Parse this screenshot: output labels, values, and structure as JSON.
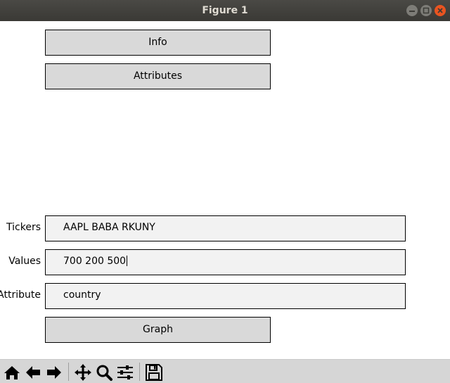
{
  "window": {
    "title": "Figure 1"
  },
  "buttons": {
    "info": "Info",
    "attributes": "Attributes",
    "graph": "Graph"
  },
  "fields": {
    "tickers": {
      "label": "Tickers",
      "value": "AAPL BABA RKUNY"
    },
    "values": {
      "label": "Values",
      "value": "700 200 500"
    },
    "attribute": {
      "label": "Attribute",
      "value": "country"
    }
  },
  "toolbar": {
    "icons": [
      "home-icon",
      "back-arrow-icon",
      "forward-arrow-icon",
      "pan-icon",
      "zoom-icon",
      "configure-subplots-icon",
      "save-icon"
    ]
  },
  "colors": {
    "titlebar": "#3c3b37",
    "close": "#e95420",
    "button_face": "#d9d9d9",
    "textbox_face": "#f2f2f2",
    "toolbar_bg": "#d6d6d6"
  }
}
